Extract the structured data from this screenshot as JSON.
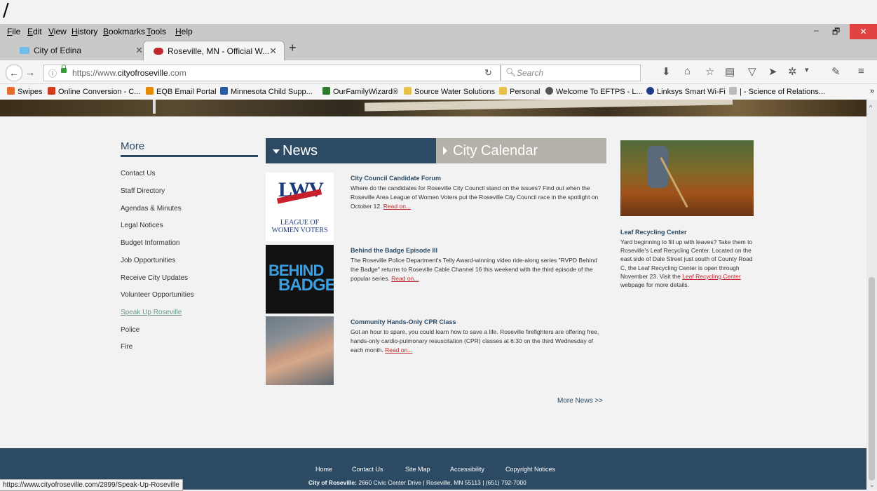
{
  "top_slash": "/",
  "menubar": {
    "items": [
      "File",
      "Edit",
      "View",
      "History",
      "Bookmarks",
      "Tools",
      "Help"
    ],
    "min_label": "–",
    "max_label": "🗗",
    "close_label": "✕"
  },
  "tabs": [
    {
      "title": "City of Edina",
      "close": "✕",
      "favicon_color": "#6fbde8"
    },
    {
      "title": "Roseville, MN - Official W...",
      "close": "✕",
      "favicon_color": "#c0282d"
    }
  ],
  "newtab_label": "+",
  "navbar": {
    "url_prefix": "https://www.",
    "url_domain": "cityofroseville",
    "url_suffix": ".com",
    "search_placeholder": "Search"
  },
  "bookmarks": [
    {
      "label": "Swipes",
      "color": "#e66b2c"
    },
    {
      "label": "Online Conversion - C...",
      "color": "#d43b1e"
    },
    {
      "label": "EQB Email Portal",
      "color": "#e68a00"
    },
    {
      "label": "Minnesota Child Supp...",
      "color": "#2a5aa0"
    },
    {
      "label": "OurFamilyWizard®",
      "color": "#2d7a2d"
    },
    {
      "label": "Source Water Solutions",
      "color": "#e6c24a"
    },
    {
      "label": "Personal",
      "color": "#e6c24a"
    },
    {
      "label": "Welcome To EFTPS - L...",
      "color": "#555555"
    },
    {
      "label": "Linksys Smart Wi-Fi",
      "color": "#1e3a8a"
    },
    {
      "label": "| - Science of Relations...",
      "color": "#bbbbbb"
    }
  ],
  "bookmarks_overflow": "»",
  "sidebar": {
    "title": "More",
    "links": [
      "Contact Us",
      "Staff Directory",
      "Agendas & Minutes",
      "Legal Notices",
      "Budget Information",
      "Job Opportunities",
      "Receive City Updates",
      "Volunteer Opportunities",
      "Speak Up Roseville",
      "Police",
      "Fire"
    ]
  },
  "tabs_content": {
    "news": "News",
    "calendar": "City Calendar"
  },
  "news": [
    {
      "title": "City Council Candidate Forum",
      "body": "Where do the candidates for Roseville City Council stand on the issues? Find out when the Roseville Area League of Women Voters put the Roseville City Council race in the spotlight on October 12.",
      "read_on": "Read on..."
    },
    {
      "title": "Behind the Badge Episode III",
      "body": "The Roseville Police Department's Telly Award-winning video ride-along series \"RVPD Behind the Badge\" returns to Roseville Cable Channel 16 this weekend with the third episode of the popular series.",
      "read_on": "Read on..."
    },
    {
      "title": "Community Hands-Only CPR Class",
      "body": "Got an hour to spare, you could learn how to save a life. Roseville firefighters are offering free, hands-only cardio-pulmonary resuscitation (CPR) classes at 6:30 on the third Wednesday of each month.",
      "read_on": "Read on..."
    }
  ],
  "lwv_logo": {
    "big": "LWV",
    "line1": "LEAGUE OF",
    "line2": "WOMEN VOTERS"
  },
  "badge_logo": {
    "line1": "BEHIND",
    "line2": "BADGE"
  },
  "more_news": "More News >>",
  "leaf": {
    "title": "Leaf Recycling Center",
    "body": "Yard beginning to fill up with leaves? Take them to Roseville's Leaf Recycling Center. Located on the east side of Dale Street just south of County Road C, the Leaf Recycling Center is open through November 23. Visit the",
    "link": "Leaf Recycling Center",
    "after": "webpage for more details."
  },
  "footer": {
    "links": [
      "Home",
      "Contact Us",
      "Site Map",
      "Accessibility",
      "Copyright Notices"
    ],
    "org": "City of Roseville:",
    "address": "2660 Civic Center Drive | Roseville, MN 55113 | (651) 792-7000"
  },
  "status_url": "https://www.cityofroseville.com/2899/Speak-Up-Roseville"
}
